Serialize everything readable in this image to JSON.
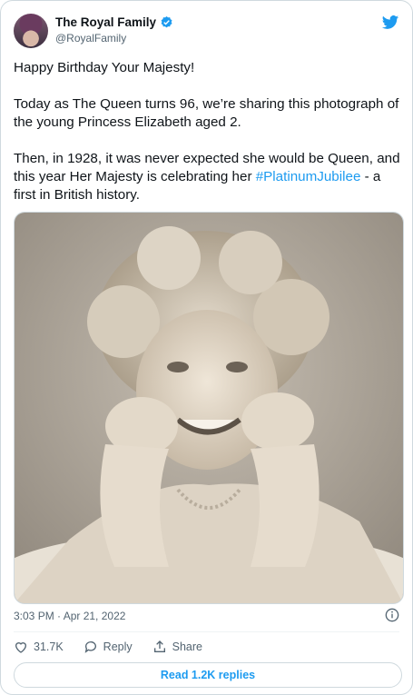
{
  "tweet": {
    "author_name": "The Royal Family",
    "handle": "@RoyalFamily",
    "paragraph1": "Happy Birthday Your Majesty!",
    "paragraph2": "Today as The Queen turns 96, we’re sharing this photograph of the young Princess Elizabeth aged 2.",
    "paragraph3_before": "Then, in 1928, it was never expected she would be Queen, and this year Her Majesty is celebrating her ",
    "hashtag": "#PlatinumJubilee",
    "paragraph3_after": " - a first in British history.",
    "timestamp": "3:03 PM · Apr 21, 2022",
    "likes": "31.7K",
    "reply_label": "Reply",
    "share_label": "Share",
    "read_replies": "Read 1.2K replies"
  },
  "colors": {
    "link": "#1d9bf0",
    "secondary_text": "#536471",
    "border": "#cfd9de"
  },
  "icons": [
    "verified-badge-icon",
    "twitter-bird-icon",
    "info-icon",
    "heart-icon",
    "reply-icon",
    "share-icon"
  ]
}
